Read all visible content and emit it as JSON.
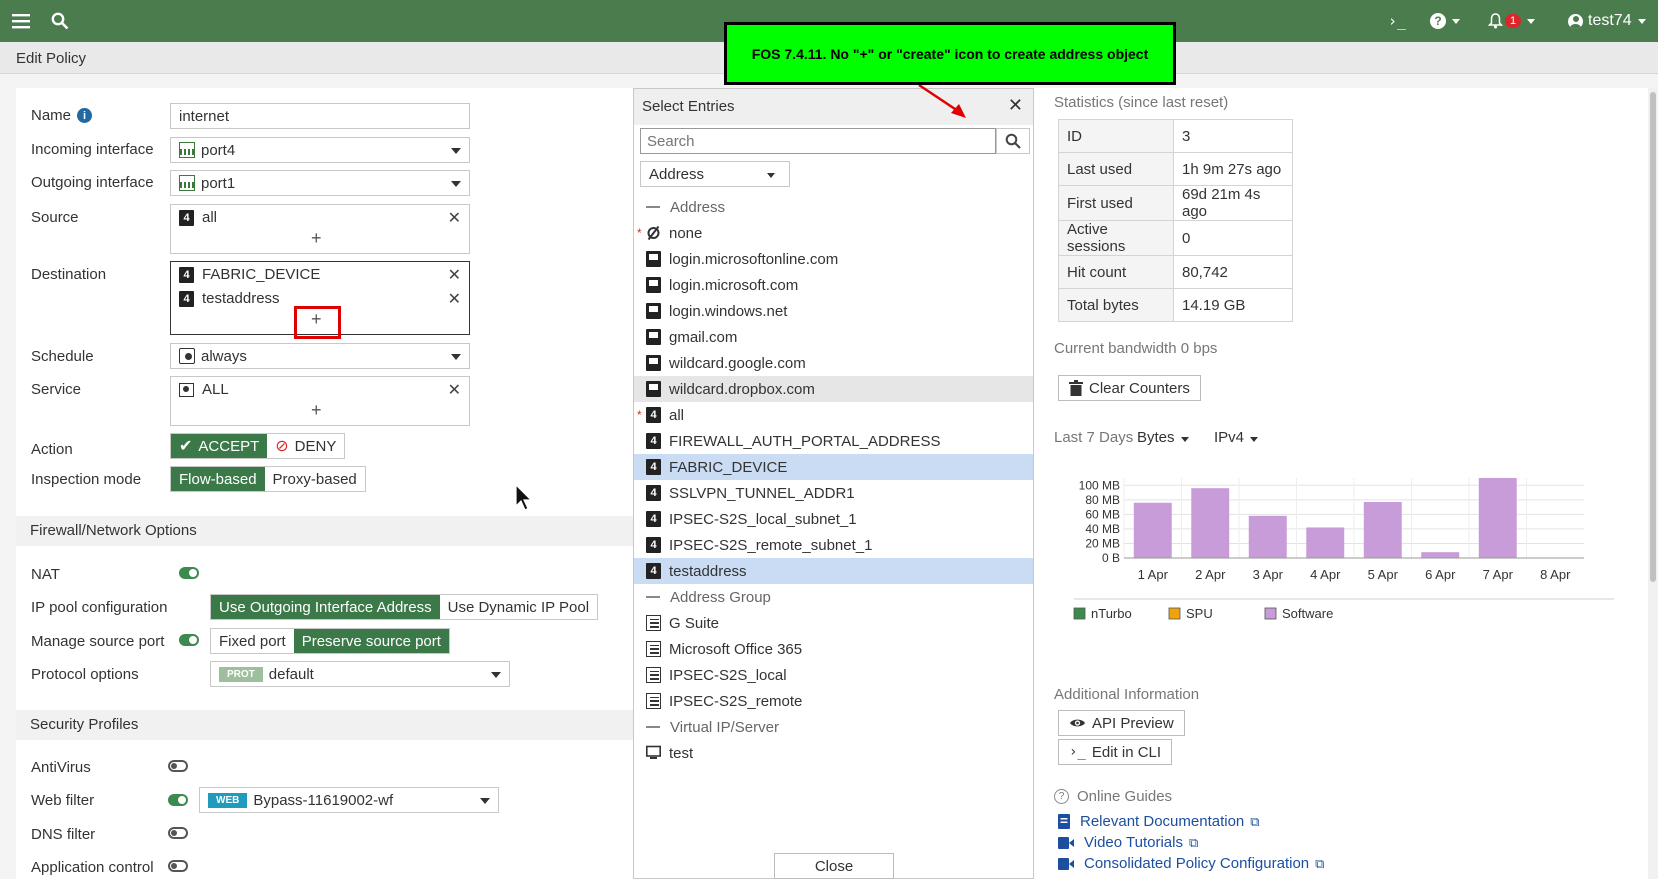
{
  "topbar": {
    "console": "›_",
    "help": "?",
    "notifications": "1",
    "user": "test74"
  },
  "subbar": {
    "title": "Edit Policy"
  },
  "form": {
    "name_label": "Name",
    "name_value": "internet",
    "incoming_label": "Incoming interface",
    "incoming_value": "port4",
    "outgoing_label": "Outgoing interface",
    "outgoing_value": "port1",
    "source_label": "Source",
    "source_items": [
      "all"
    ],
    "destination_label": "Destination",
    "destination_items": [
      "FABRIC_DEVICE",
      "testaddress"
    ],
    "schedule_label": "Schedule",
    "schedule_value": "always",
    "service_label": "Service",
    "service_items": [
      "ALL"
    ],
    "action_label": "Action",
    "accept": "ACCEPT",
    "deny": "DENY",
    "inspection_label": "Inspection mode",
    "flow": "Flow-based",
    "proxy": "Proxy-based",
    "plus": "+"
  },
  "firewall_section": {
    "title": "Firewall/Network Options",
    "nat_label": "NAT",
    "ippool_label": "IP pool configuration",
    "use_outgoing": "Use Outgoing Interface Address",
    "use_dynamic": "Use Dynamic IP Pool",
    "srcport_label": "Manage source port",
    "fixed_port": "Fixed port",
    "preserve_port": "Preserve source port",
    "protocol_label": "Protocol options",
    "protocol_tag": "PROT",
    "protocol_value": "default"
  },
  "security_section": {
    "title": "Security Profiles",
    "antivirus_label": "AntiVirus",
    "webfilter_label": "Web filter",
    "webfilter_tag": "WEB",
    "webfilter_value": "Bypass-11619002-wf",
    "dnsfilter_label": "DNS filter",
    "appcontrol_label": "Application control"
  },
  "select_entries": {
    "title": "Select Entries",
    "search_placeholder": "Search",
    "type_value": "Address",
    "close": "Close",
    "entries": [
      {
        "label": "Address",
        "kind": "group"
      },
      {
        "label": "none",
        "kind": "none",
        "star": true
      },
      {
        "label": "login.microsoftonline.com",
        "kind": "fqdn"
      },
      {
        "label": "login.microsoft.com",
        "kind": "fqdn"
      },
      {
        "label": "login.windows.net",
        "kind": "fqdn"
      },
      {
        "label": "gmail.com",
        "kind": "fqdn"
      },
      {
        "label": "wildcard.google.com",
        "kind": "fqdn"
      },
      {
        "label": "wildcard.dropbox.com",
        "kind": "fqdn",
        "hover": true
      },
      {
        "label": "all",
        "kind": "v4",
        "star": true
      },
      {
        "label": "FIREWALL_AUTH_PORTAL_ADDRESS",
        "kind": "v4"
      },
      {
        "label": "FABRIC_DEVICE",
        "kind": "v4",
        "selected": true
      },
      {
        "label": "SSLVPN_TUNNEL_ADDR1",
        "kind": "v4"
      },
      {
        "label": "IPSEC-S2S_local_subnet_1",
        "kind": "v4"
      },
      {
        "label": "IPSEC-S2S_remote_subnet_1",
        "kind": "v4"
      },
      {
        "label": "testaddress",
        "kind": "v4",
        "selected": true
      },
      {
        "label": "Address Group",
        "kind": "group"
      },
      {
        "label": "G Suite",
        "kind": "addrgrp"
      },
      {
        "label": "Microsoft Office 365",
        "kind": "addrgrp"
      },
      {
        "label": "IPSEC-S2S_local",
        "kind": "addrgrp"
      },
      {
        "label": "IPSEC-S2S_remote",
        "kind": "addrgrp"
      },
      {
        "label": "Virtual IP/Server",
        "kind": "group"
      },
      {
        "label": "test",
        "kind": "vip"
      }
    ]
  },
  "stats": {
    "title": "Statistics (since last reset)",
    "rows": [
      {
        "k": "ID",
        "v": "3"
      },
      {
        "k": "Last used",
        "v": "1h 9m 27s ago"
      },
      {
        "k": "First used",
        "v": "69d 21m 4s ago"
      },
      {
        "k": "Active sessions",
        "v": "0"
      },
      {
        "k": "Hit count",
        "v": "80,742"
      },
      {
        "k": "Total bytes",
        "v": "14.19 GB"
      }
    ],
    "bandwidth": "Current bandwidth 0 bps",
    "clear": "Clear Counters",
    "period": "Last 7 Days",
    "unit": "Bytes",
    "ipver": "IPv4"
  },
  "chart_data": {
    "type": "bar",
    "categories": [
      "1 Apr",
      "2 Apr",
      "3 Apr",
      "4 Apr",
      "5 Apr",
      "6 Apr",
      "7 Apr",
      "8 Apr"
    ],
    "yticks": [
      "0 B",
      "20 MB",
      "40 MB",
      "60 MB",
      "80 MB",
      "100 MB"
    ],
    "ylim": [
      0,
      110
    ],
    "series": [
      {
        "name": "nTurbo",
        "color": "#3c8a4e",
        "values": [
          0,
          0,
          0,
          0,
          0,
          0,
          0,
          0
        ]
      },
      {
        "name": "SPU",
        "color": "#f0a30a",
        "values": [
          0,
          0,
          0,
          0,
          0,
          0,
          0,
          0
        ]
      },
      {
        "name": "Software",
        "color": "#c89bd9",
        "values": [
          76,
          96,
          58,
          42,
          77,
          8,
          112,
          0
        ]
      }
    ]
  },
  "additional": {
    "title": "Additional Information",
    "api_preview": "API Preview",
    "edit_cli": "Edit in CLI",
    "guides_title": "Online Guides",
    "links": [
      "Relevant Documentation",
      "Video Tutorials",
      "Consolidated Policy Configuration"
    ]
  },
  "annotation": {
    "text": "FOS 7.4.11. No \"+\" or \"create\" icon to create address object"
  },
  "colors": {
    "brand": "#4a7c4e",
    "accent": "#3b7a48",
    "selection": "#c9dcf4",
    "annotation": "#00ff00"
  }
}
